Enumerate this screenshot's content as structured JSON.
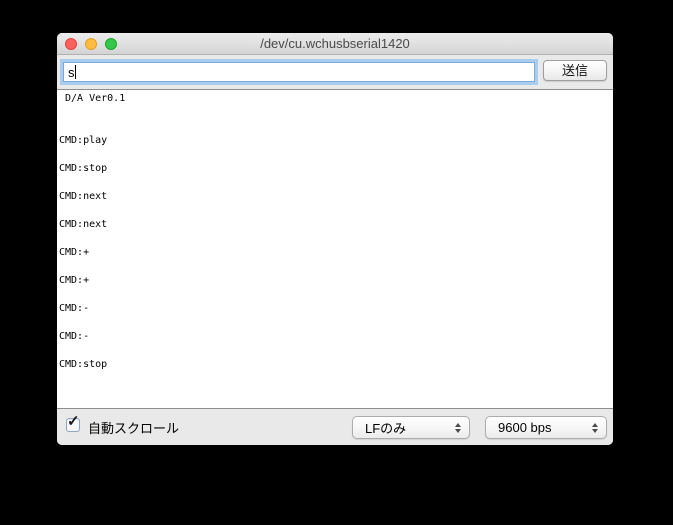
{
  "window": {
    "title": "/dev/cu.wchusbserial1420"
  },
  "toolbar": {
    "input_value": "s",
    "send_label": "送信"
  },
  "terminal": {
    "lines": [
      " D/A Ver0.1",
      "",
      "",
      "CMD:play",
      "",
      "CMD:stop",
      "",
      "CMD:next",
      "",
      "CMD:next",
      "",
      "CMD:+",
      "",
      "CMD:+",
      "",
      "CMD:-",
      "",
      "CMD:-",
      "",
      "CMD:stop"
    ]
  },
  "statusbar": {
    "autoscroll_label": "自動スクロール",
    "autoscroll_checked": true,
    "line_ending_selected": "LFのみ",
    "baud_selected": "9600 bps"
  },
  "icons": {
    "checkmark": "✓"
  },
  "colors": {
    "focus_ring": "#a9cdee",
    "traffic_red": "#fc615d",
    "traffic_yellow": "#fdbc40",
    "traffic_green": "#34c749",
    "window_bg": "#e9e9e9",
    "terminal_bg": "#ffffff",
    "terminal_text": "#000000"
  }
}
